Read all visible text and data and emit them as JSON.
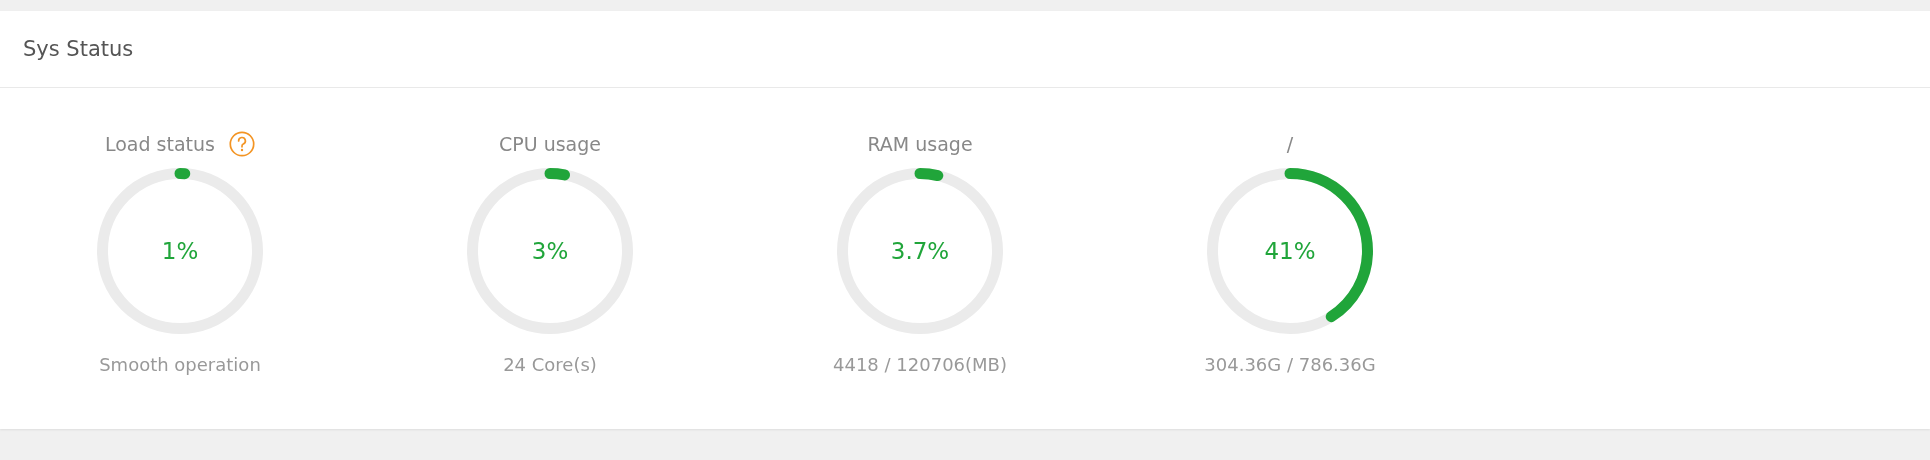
{
  "panel": {
    "title": "Sys Status"
  },
  "gauges": [
    {
      "label": "Load status",
      "help": true,
      "level": 0.01,
      "value": "1%",
      "detail": "Smooth operation"
    },
    {
      "label": "CPU usage",
      "help": false,
      "level": 0.03,
      "value": "3%",
      "detail": "24 Core(s)"
    },
    {
      "label": "RAM usage",
      "help": false,
      "level": 0.037,
      "value": "3.7%",
      "detail": "4418 / 120706(MB)"
    },
    {
      "label": "/",
      "help": false,
      "level": 0.41,
      "value": "41%",
      "detail": "304.36G / 786.36G"
    }
  ]
}
